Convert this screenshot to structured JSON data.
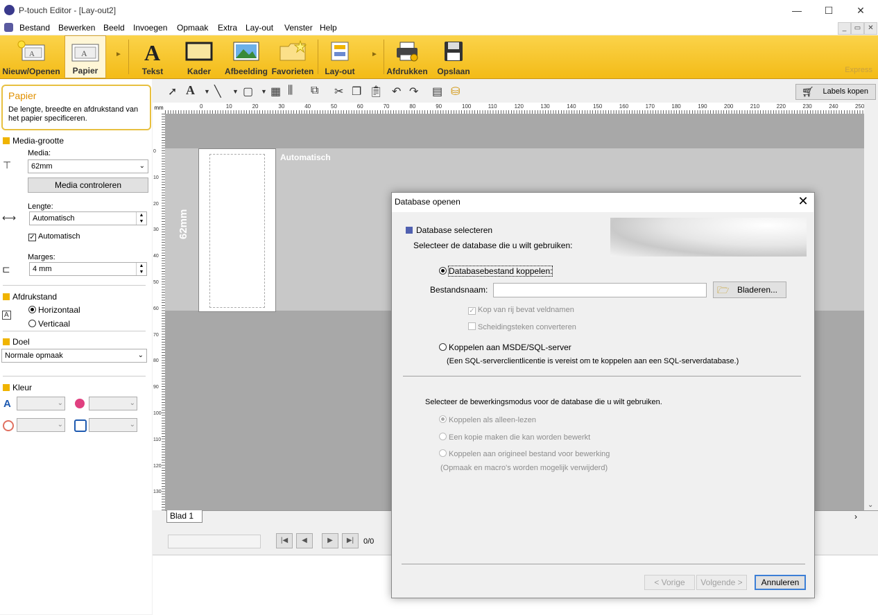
{
  "window": {
    "title": "P-touch Editor - [Lay-out2]",
    "minimize": "—",
    "maximize": "☐",
    "close": "✕",
    "mdi_min": "_",
    "mdi_restore": "▭",
    "mdi_close": "✕"
  },
  "menu": [
    "Bestand",
    "Bewerken",
    "Beeld",
    "Invoegen",
    "Opmaak",
    "Extra",
    "Lay-out",
    "Venster",
    "Help"
  ],
  "ribbon": {
    "new_open": "Nieuw/Openen",
    "paper": "Papier",
    "text": "Tekst",
    "frame": "Kader",
    "image": "Afbeelding",
    "favorites": "Favorieten",
    "layout": "Lay-out",
    "print": "Afdrukken",
    "save": "Opslaan",
    "brand": "Express"
  },
  "toolbar": {
    "buy_labels": "Labels kopen"
  },
  "left_panel": {
    "title": "Papier",
    "description": "De lengte, breedte en afdrukstand van het papier specificeren.",
    "media_size_header": "Media-grootte",
    "media_label": "Media:",
    "media_value": "62mm",
    "check_media_button": "Media controleren",
    "length_label": "Lengte:",
    "length_value": "Automatisch",
    "auto_checkbox": "Automatisch",
    "margins_label": "Marges:",
    "margins_value": "4 mm",
    "orientation_header": "Afdrukstand",
    "horizontal": "Horizontaal",
    "vertical": "Verticaal",
    "target_header": "Doel",
    "target_value": "Normale opmaak",
    "color_header": "Kleur"
  },
  "canvas": {
    "ruler_unit": "mm",
    "auto_label": "Automatisch",
    "width_label": "62mm",
    "sheet_tab": "Blad 1"
  },
  "ruler_h": [
    "0",
    "10",
    "20",
    "30",
    "40",
    "50",
    "60",
    "70",
    "80",
    "90",
    "100",
    "110",
    "120",
    "130",
    "140",
    "150",
    "160",
    "170",
    "180",
    "190",
    "200",
    "210",
    "220",
    "230",
    "240",
    "250"
  ],
  "ruler_v": [
    "0",
    "10",
    "20",
    "30",
    "40",
    "50",
    "60",
    "70",
    "80",
    "90",
    "100",
    "110",
    "120",
    "130"
  ],
  "bottom_panel": {
    "record_count": "0/0"
  },
  "dialog": {
    "title": "Database openen",
    "close": "✕",
    "section_header": "Database selecteren",
    "select_prompt": "Selecteer de database die u wilt gebruiken:",
    "option_file": "Databasebestand koppelen:",
    "filename_label": "Bestandsnaam:",
    "filename_value": "",
    "browse_button": "Bladeren...",
    "header_row_checkbox": "Kop van rij bevat veldnamen",
    "convert_separator_checkbox": "Scheidingsteken converteren",
    "option_sql": "Koppelen aan MSDE/SQL-server",
    "sql_note": "(Een SQL-serverclientlicentie is vereist om te koppelen aan een SQL-serverdatabase.)",
    "edit_mode_prompt": "Selecteer de bewerkingsmodus voor de database die u wilt gebruiken.",
    "mode_readonly": "Koppelen als alleen-lezen",
    "mode_copy": "Een kopie maken die kan worden bewerkt",
    "mode_original": "Koppelen aan origineel bestand voor bewerking",
    "mode_note": "(Opmaak en macro's worden mogelijk verwijderd)",
    "prev_button": "< Vorige",
    "next_button": "Volgende >",
    "cancel_button": "Annuleren"
  },
  "colors": {
    "ribbon": "#f3bb17",
    "accent": "#f0b400",
    "dialog_header_square": "#5060b0"
  }
}
